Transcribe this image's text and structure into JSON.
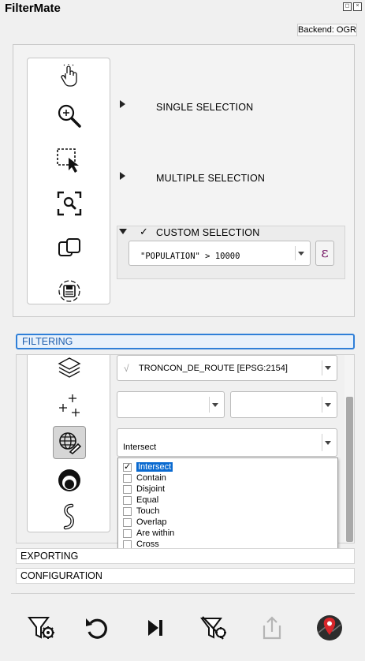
{
  "window": {
    "title": "FilterMate",
    "backend_label": "Backend: OGR"
  },
  "selection": {
    "tools": [
      "pointer-click-icon",
      "zoom-in-icon",
      "rect-select-icon",
      "zoom-selection-icon",
      "link-layers-icon",
      "save-layer-icon"
    ],
    "single_label": "SINGLE SELECTION",
    "multiple_label": "MULTIPLE SELECTION",
    "custom_label": "CUSTOM SELECTION",
    "custom_checked": "✓",
    "expression_value": "\"POPULATION\" > 10000",
    "expression_button": "ε"
  },
  "filtering": {
    "header": "FILTERING",
    "tools": [
      "layers-icon",
      "add-points-icon",
      "geo-predicate-icon",
      "buffer-icon",
      "curve-icon"
    ],
    "layer_combo": {
      "prefix": "√",
      "value": "TRONCON_DE_ROUTE [EPSG:2154]"
    },
    "predicate_combo": {
      "value": "Intersect"
    },
    "predicates": [
      {
        "label": "Intersect",
        "checked": "✓"
      },
      {
        "label": "Contain",
        "checked": ""
      },
      {
        "label": "Disjoint",
        "checked": ""
      },
      {
        "label": "Equal",
        "checked": ""
      },
      {
        "label": "Touch",
        "checked": ""
      },
      {
        "label": "Overlap",
        "checked": ""
      },
      {
        "label": "Are within",
        "checked": ""
      },
      {
        "label": "Cross",
        "checked": ""
      }
    ]
  },
  "sections": {
    "exporting": "EXPORTING",
    "configuration": "CONFIGURATION"
  },
  "bottom_actions": [
    "filter-settings-icon",
    "undo-icon",
    "skip-next-icon",
    "clear-filter-icon",
    "export-icon",
    "map-pin-icon"
  ],
  "colors": {
    "accent": "#2f7fd8",
    "selection": "#0a6ad0",
    "epsilon": "#7a1f6a",
    "pin": "#d7262b",
    "disabled": "#b5b5b5"
  }
}
